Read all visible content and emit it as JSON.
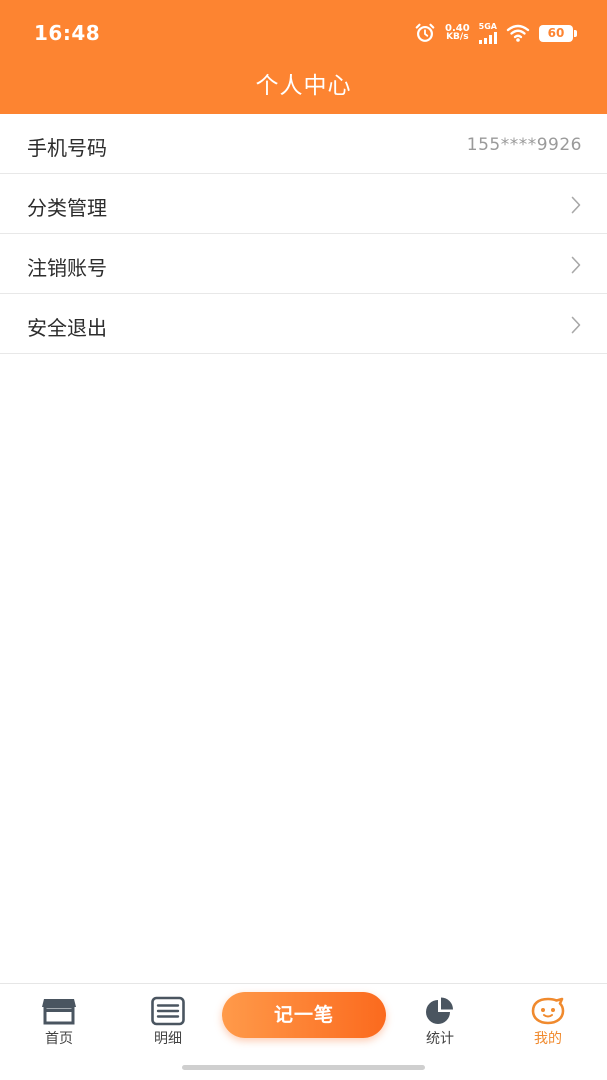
{
  "status_bar": {
    "time": "16:48",
    "net_speed_value": "0.40",
    "net_speed_unit": "KB/s",
    "network_type": "5GA",
    "battery": "60"
  },
  "header": {
    "title": "个人中心"
  },
  "menu": {
    "phone": {
      "label": "手机号码",
      "value": "155****9926"
    },
    "category": {
      "label": "分类管理"
    },
    "delete_account": {
      "label": "注销账号"
    },
    "logout": {
      "label": "安全退出"
    }
  },
  "tabbar": {
    "home": "首页",
    "details": "明细",
    "record": "记一笔",
    "stats": "统计",
    "mine": "我的",
    "active": "mine",
    "accent_color": "#fd8431"
  }
}
